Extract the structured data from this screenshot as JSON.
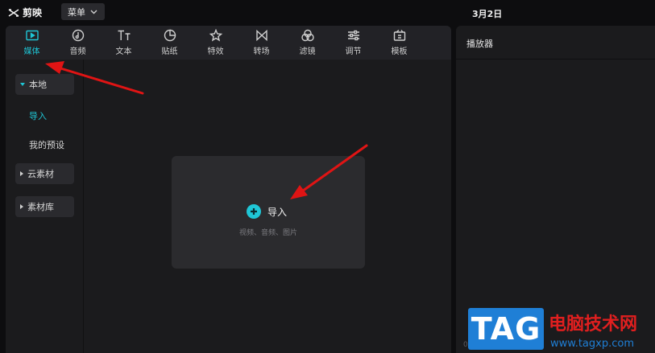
{
  "app": {
    "name": "剪映",
    "menu_label": "菜单",
    "date": "3月2日"
  },
  "toolbar": {
    "items": [
      {
        "label": "媒体",
        "icon": "media-icon",
        "active": true
      },
      {
        "label": "音频",
        "icon": "audio-icon",
        "active": false
      },
      {
        "label": "文本",
        "icon": "text-icon",
        "active": false
      },
      {
        "label": "贴纸",
        "icon": "sticker-icon",
        "active": false
      },
      {
        "label": "特效",
        "icon": "effects-icon",
        "active": false
      },
      {
        "label": "转场",
        "icon": "transition-icon",
        "active": false
      },
      {
        "label": "滤镜",
        "icon": "filter-icon",
        "active": false
      },
      {
        "label": "调节",
        "icon": "adjust-icon",
        "active": false
      },
      {
        "label": "模板",
        "icon": "template-icon",
        "active": false
      }
    ]
  },
  "sidebar": {
    "local": "本地",
    "import": "导入",
    "presets": "我的预设",
    "cloud": "云素材",
    "library": "素材库"
  },
  "import_area": {
    "button_label": "导入",
    "hint": "视频、音频、图片"
  },
  "player": {
    "title": "播放器",
    "timecode": "00"
  },
  "watermark": {
    "logo_text": "TAG",
    "site_name": "电脑技术网",
    "url": "www.tagxp.com"
  },
  "colors": {
    "accent": "#1fc6d6",
    "arrow": "#e01414",
    "panel_bg": "#1b1b1d",
    "app_bg": "#0d0d0f"
  }
}
